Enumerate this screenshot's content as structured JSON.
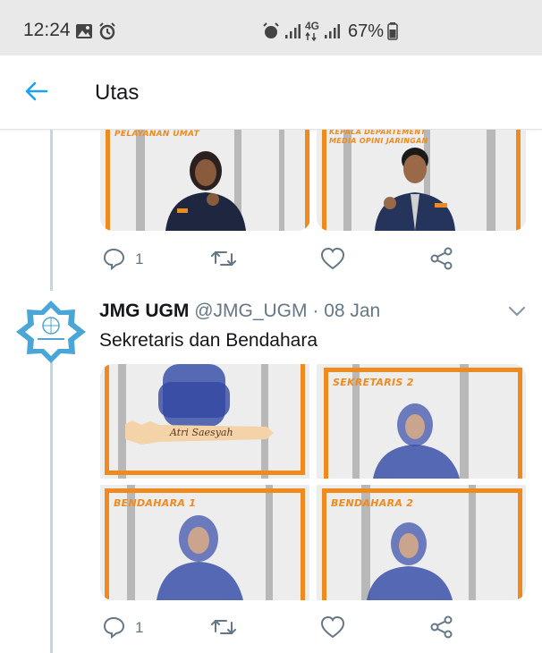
{
  "status": {
    "time": "12:24",
    "network": "4G",
    "battery": "67%"
  },
  "header": {
    "title": "Utas"
  },
  "prev_tweet": {
    "photos": [
      {
        "caption": "PELAYANAN UMAT"
      },
      {
        "caption": "KEPALA DEPARTEMENT\nMEDIA OPINI JARINGAN"
      }
    ],
    "reply_count": "1"
  },
  "tweet": {
    "name": "JMG UGM",
    "handle": "@JMG_UGM",
    "date": "08 Jan",
    "separator": " · ",
    "text": "Sekretaris dan Bendahara",
    "photos": [
      {
        "caption": "",
        "signature": "Atri Saesyah"
      },
      {
        "caption": "SEKRETARIS 2"
      },
      {
        "caption": "BENDAHARA 1"
      },
      {
        "caption": "BENDAHARA 2"
      }
    ],
    "reply_count": "1"
  },
  "colors": {
    "accent": "#1da1f2",
    "frame": "#ef8a1e",
    "icon": "#657786"
  }
}
